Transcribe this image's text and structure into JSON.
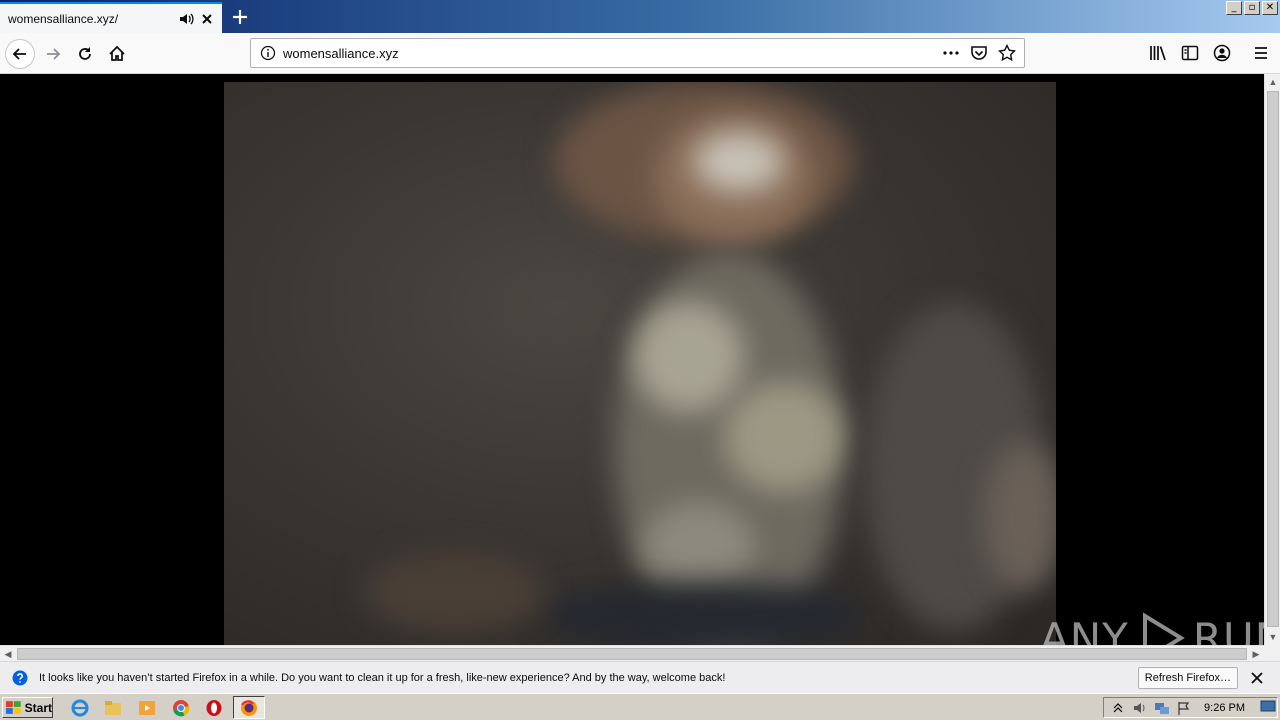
{
  "tab": {
    "title": "womensalliance.xyz/"
  },
  "window_controls": {
    "minimize": "_",
    "maximize": "▫",
    "close": "✕"
  },
  "urlbar": {
    "url": "womensalliance.xyz"
  },
  "watermark": {
    "text_a": "ANY",
    "text_b": "RUN"
  },
  "notification": {
    "message": "It looks like you haven’t started Firefox in a while. Do you want to clean it up for a fresh, like-new experience? And by the way, welcome back!",
    "button": "Refresh Firefox…"
  },
  "taskbar": {
    "start_label": "Start",
    "clock": "9:26 PM"
  },
  "colors": {
    "accent": "#0a84ff",
    "titlebar_start": "#0a246a",
    "titlebar_end": "#a6caf0"
  },
  "icons": [
    "audio-icon",
    "close-icon",
    "new-tab-icon",
    "back-icon",
    "forward-icon",
    "reload-icon",
    "home-icon",
    "info-icon",
    "more-icon",
    "pocket-icon",
    "bookmark-star-icon",
    "library-icon",
    "sidebar-icon",
    "account-icon",
    "hamburger-menu-icon"
  ]
}
